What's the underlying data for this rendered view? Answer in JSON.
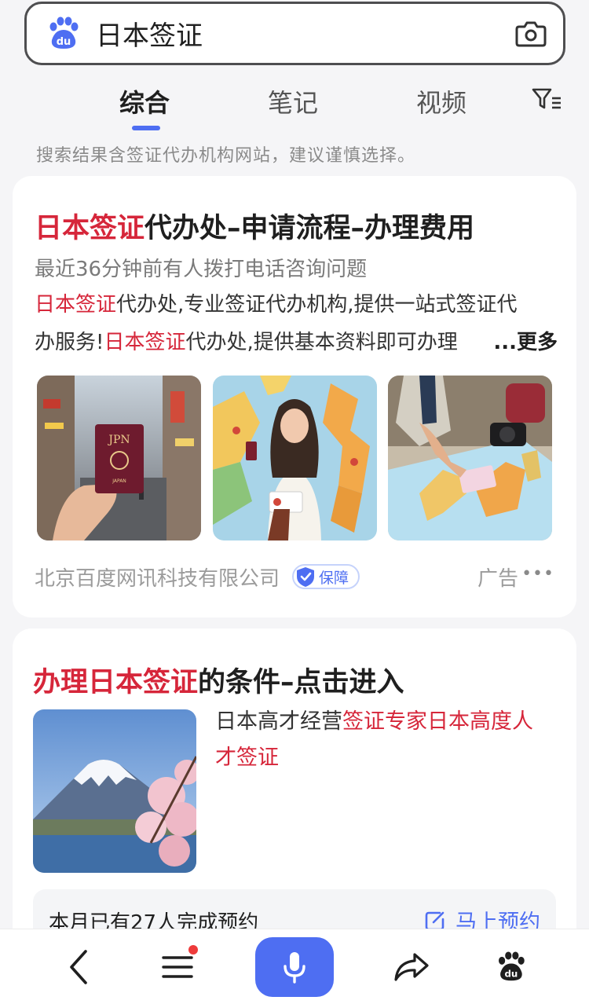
{
  "search": {
    "query": "日本签证"
  },
  "tabs": [
    {
      "label": "综合",
      "active": true
    },
    {
      "label": "笔记",
      "active": false
    },
    {
      "label": "视频",
      "active": false
    }
  ],
  "notice": "搜索结果含签证代办机构网站，建议谨慎选择。",
  "ad_card": {
    "title_highlight": "日本签证",
    "title_rest": "代办处–申请流程–办理费用",
    "subtitle": "最近36分钟前有人拨打电话咨询问题",
    "desc_line1_hl": "日本签证",
    "desc_line1_rest": "代办处,专业签证代办机构,提供一站式签证代",
    "desc_line2_pre": "办服务!",
    "desc_line2_hl": "日本签证",
    "desc_line2_rest": "代办处,提供基本资料即可办理",
    "more": "...更多",
    "passport_label": "JPN",
    "passport_sublabel": "JAPAN",
    "company": "北京百度网讯科技有限公司",
    "badge": "保障",
    "ad_label": "广告"
  },
  "card2": {
    "title_highlight": "办理日本签证",
    "title_rest": "的条件–点击进入",
    "desc_pre": "日本高才经营",
    "desc_hl": "签证专家日本高度人才签证",
    "booking_text": "本月已有27人完成预约",
    "booking_button": "马上预约"
  },
  "colors": {
    "accent": "#4e6ef2",
    "highlight": "#d6263a"
  }
}
